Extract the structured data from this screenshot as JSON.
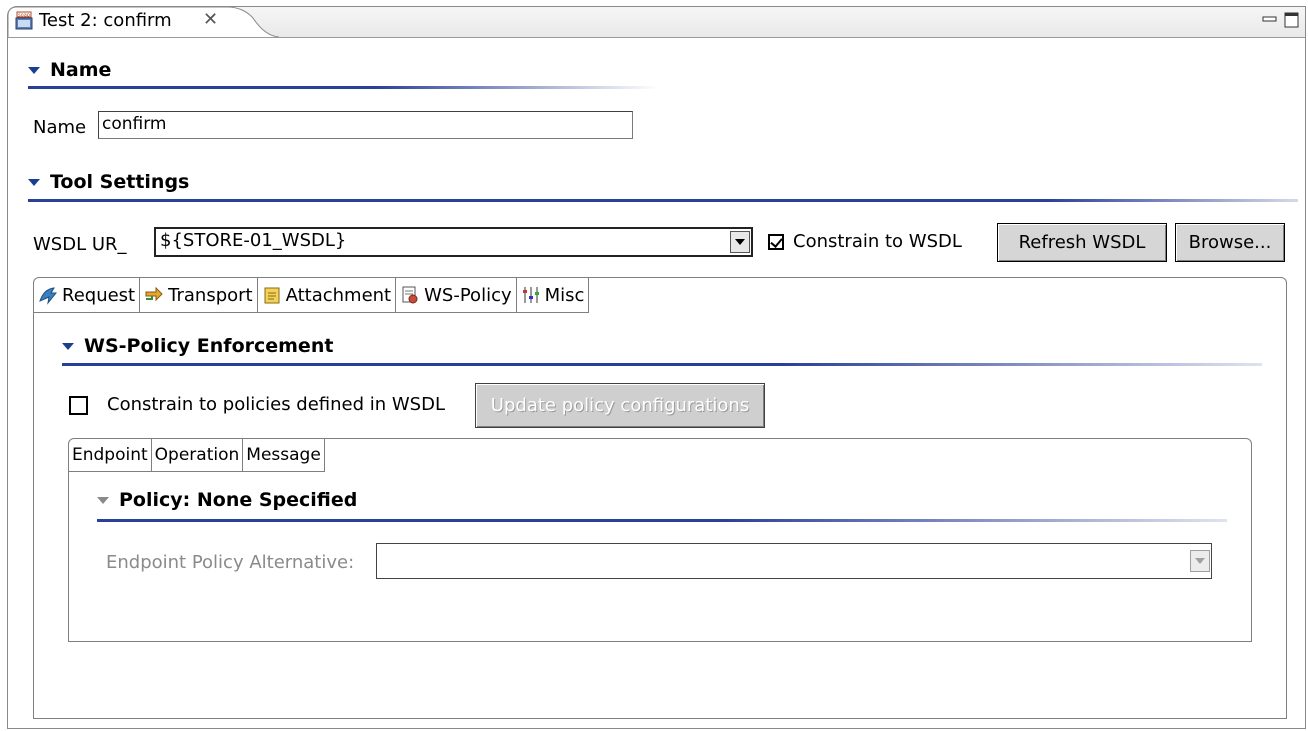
{
  "editor_tab": {
    "title": "Test 2: confirm",
    "icon": "soap-icon",
    "close_icon": "close-icon"
  },
  "window_controls": {
    "minimize": "minimize-icon",
    "maximize": "maximize-icon"
  },
  "name_section": {
    "title": "Name",
    "label": "Name",
    "value": "confirm"
  },
  "tool_settings": {
    "title": "Tool Settings",
    "wsdl_label": "WSDL UR_",
    "wsdl_value": "${STORE-01_WSDL}",
    "constrain_label": "Constrain to WSDL",
    "constrain_checked": true,
    "refresh_label": "Refresh WSDL",
    "browse_label": "Browse..."
  },
  "tabs": [
    {
      "label": "Request",
      "icon": "request-icon"
    },
    {
      "label": "Transport",
      "icon": "transport-icon"
    },
    {
      "label": "Attachment",
      "icon": "attachment-icon"
    },
    {
      "label": "WS-Policy",
      "icon": "ws-policy-icon",
      "active": true
    },
    {
      "label": "Misc",
      "icon": "misc-icon"
    }
  ],
  "ws_policy": {
    "title": "WS-Policy Enforcement",
    "constrain_label": "Constrain to policies defined in WSDL",
    "constrain_checked": false,
    "update_label": "Update policy configurations",
    "inner_tabs": [
      "Endpoint",
      "Operation",
      "Message"
    ],
    "policy_title": "Policy: None Specified",
    "alternative_label": "Endpoint Policy Alternative:",
    "alternative_value": ""
  },
  "colors": {
    "section_line": "#2a3f96",
    "button_bg": "#d6d6d6"
  }
}
